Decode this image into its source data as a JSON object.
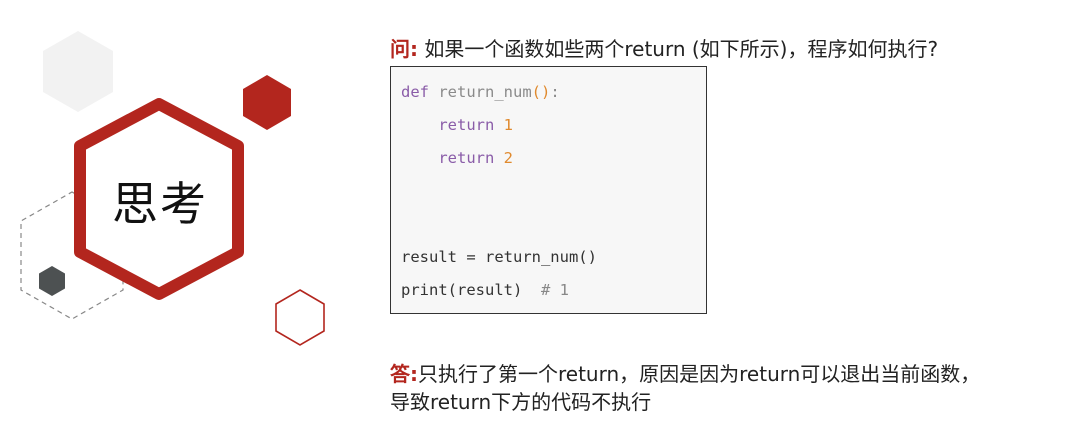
{
  "badge": {
    "label": "思考"
  },
  "question": {
    "label": "问:",
    "text": " 如果一个函数如些两个return (如下所示)，程序如何执行?"
  },
  "code": {
    "line1": {
      "kw": "def",
      "name": " return_num",
      "open": "(",
      "close": ")",
      "colon": ":"
    },
    "line2": {
      "kw": "return",
      "num": "1"
    },
    "line3": {
      "kw": "return",
      "num": "2"
    },
    "line4": {
      "text": "result = return_num()"
    },
    "line5": {
      "text": "print(result)",
      "comment": "# 1"
    }
  },
  "answer": {
    "label": "答:",
    "line1": "只执行了第一个return，原因是因为return可以退出当前函数，",
    "line2": "导致return下方的代码不执行"
  },
  "colors": {
    "accent": "#b3261e",
    "dark_hex": "#4d5152",
    "light_hex": "#f2f2f2"
  }
}
